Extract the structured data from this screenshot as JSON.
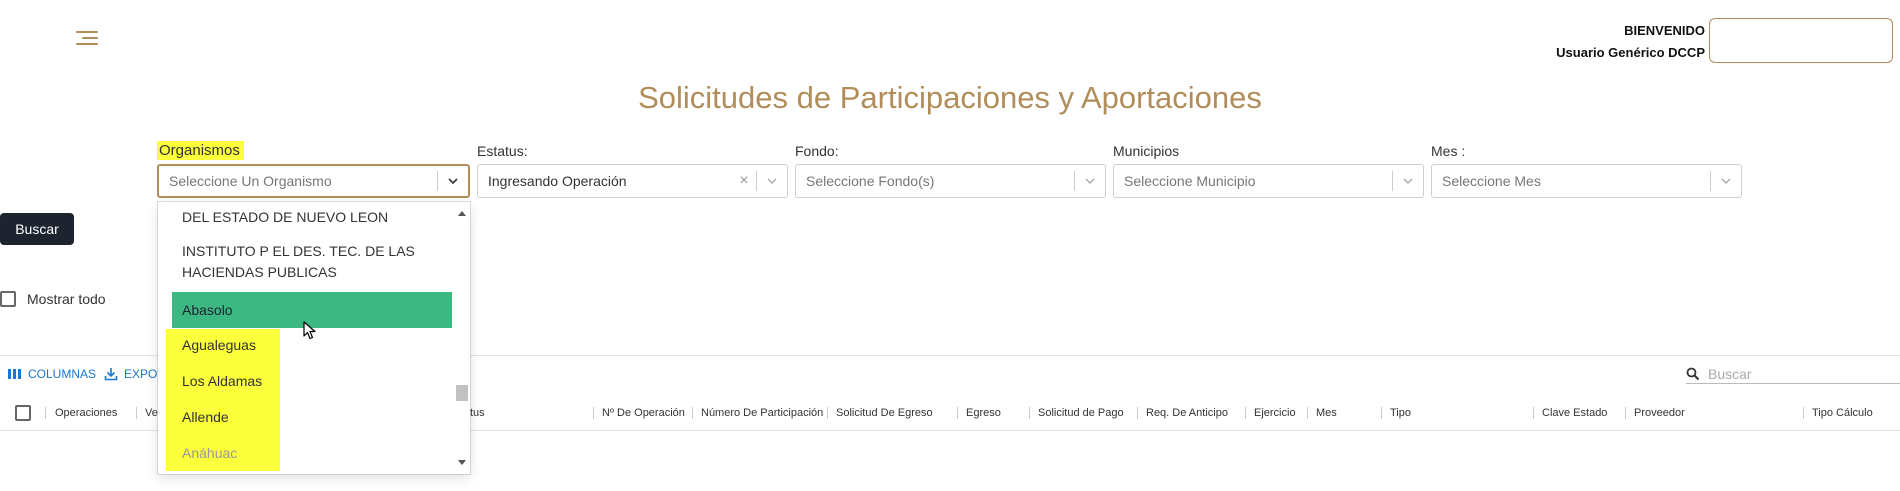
{
  "header": {
    "welcome": "BIENVENIDO",
    "user": "Usuario Genérico DCCP"
  },
  "page_title": "Solicitudes de Participaciones y Aportaciones",
  "filters": {
    "organismos": {
      "label": "Organismos",
      "placeholder": "Seleccione Un Organismo"
    },
    "estatus": {
      "label": "Estatus:",
      "value": "Ingresando Operación"
    },
    "fondo": {
      "label": "Fondo:",
      "placeholder": "Seleccione Fondo(s)"
    },
    "municipios": {
      "label": "Municipios",
      "placeholder": "Seleccione Municipio"
    },
    "mes": {
      "label": "Mes :",
      "placeholder": "Seleccione Mes"
    }
  },
  "buscar_button": "Buscar",
  "mostrar_todo": "Mostrar todo",
  "toolbar": {
    "columns": "COLUMNAS",
    "export": "EXPO",
    "search_placeholder": "Buscar"
  },
  "table": {
    "columns": [
      "Operaciones",
      "Ve",
      "tus",
      "Nº De Operación",
      "Número De Participación",
      "Solicitud De Egreso",
      "Egreso",
      "Solicitud de Pago",
      "Req. De Anticipo",
      "Ejercicio",
      "Mes",
      "Tipo",
      "Clave Estado",
      "Proveedor",
      "Tipo Cálculo"
    ]
  },
  "dropdown_options": [
    "DEL ESTADO DE NUEVO LEON",
    "INSTITUTO P EL DES. TEC. DE LAS",
    "HACIENDAS PUBLICAS",
    "Abasolo",
    "Agualeguas",
    "Los Aldamas",
    "Allende",
    "Anáhuac"
  ],
  "colors": {
    "accent": "#b08d5a",
    "selected": "#3cb882",
    "highlight": "#fcff3c",
    "button": "#1d2430",
    "link": "#1976d2"
  }
}
